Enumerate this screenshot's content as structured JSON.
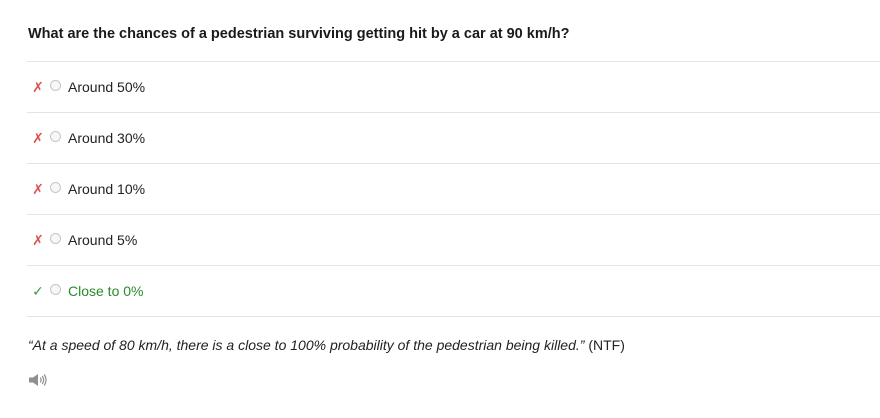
{
  "question": {
    "text": "What are the chances of a pedestrian surviving getting hit by a car at 90 km/h?"
  },
  "answers": [
    {
      "label": "Around 50%",
      "mark": "✗",
      "status": "wrong"
    },
    {
      "label": "Around 30%",
      "mark": "✗",
      "status": "wrong"
    },
    {
      "label": "Around 10%",
      "mark": "✗",
      "status": "wrong"
    },
    {
      "label": "Around 5%",
      "mark": "✗",
      "status": "wrong"
    },
    {
      "label": "Close to 0%",
      "mark": "✓",
      "status": "correct"
    }
  ],
  "explanation": {
    "quote": "“At a speed of 80 km/h, there is a close to 100% probability of the pedestrian being killed.”",
    "source": " (NTF)"
  },
  "icons": {
    "audio": "speaker-icon"
  },
  "colors": {
    "wrong": "#d9534f",
    "correct": "#2a8a2a",
    "divider": "#e4e4e4"
  }
}
